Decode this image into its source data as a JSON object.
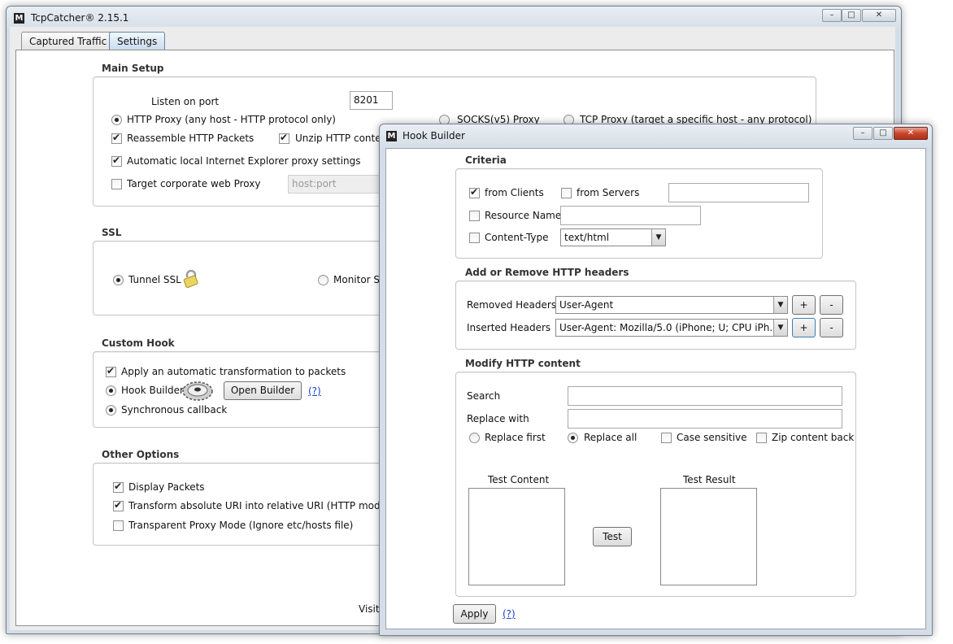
{
  "main_window": {
    "title": "TcpCatcher® 2.15.1",
    "tabs": [
      {
        "label": "Captured Traffic",
        "active": false
      },
      {
        "label": "Settings",
        "active": true
      }
    ],
    "main_setup": {
      "title": "Main Setup",
      "listen_label": "Listen on port",
      "listen_value": "8201",
      "http_proxy": "HTTP Proxy (any host - HTTP protocol only)",
      "socks_proxy": "SOCKS(v5) Proxy",
      "tcp_proxy": "TCP Proxy (target a specific host - any protocol)",
      "reassemble": "Reassemble HTTP Packets",
      "unzip": "Unzip HTTP conten",
      "ie_proxy": "Automatic local Internet Explorer proxy settings",
      "corp_proxy": "Target corporate web Proxy",
      "corp_placeholder": "host:port"
    },
    "ssl": {
      "title": "SSL",
      "tunnel": "Tunnel SSL",
      "monitor": "Monitor SS"
    },
    "custom_hook": {
      "title": "Custom Hook",
      "apply_auto": "Apply an automatic transformation to packets",
      "hook_builder": "Hook Builder",
      "open_builder": "Open Builder",
      "help": "(?)",
      "sync": "Synchronous callback"
    },
    "other": {
      "title": "Other Options",
      "display_packets": "Display Packets",
      "transform_uri": "Transform absolute URI into relative URI (HTTP mode or",
      "transparent": "Transparent Proxy Mode (Ignore etc/hosts file)"
    },
    "footer_text": "Visit"
  },
  "hook_window": {
    "title": "Hook Builder",
    "criteria": {
      "title": "Criteria",
      "from_clients": "from Clients",
      "from_servers": "from Servers",
      "resource_name": "Resource Name",
      "content_type": "Content-Type",
      "content_type_value": "text/html"
    },
    "headers": {
      "title": "Add or Remove HTTP headers",
      "removed_label": "Removed Headers",
      "removed_value": "User-Agent",
      "inserted_label": "Inserted Headers",
      "inserted_value": "User-Agent:    Mozilla/5.0 (iPhone; U; CPU iPh...",
      "plus": "+",
      "minus": "-"
    },
    "modify": {
      "title": "Modify HTTP content",
      "search_label": "Search",
      "replace_label": "Replace with",
      "replace_first": "Replace first",
      "replace_all": "Replace all",
      "case_sensitive": "Case sensitive",
      "zip_back": "Zip content back",
      "test_content": "Test Content",
      "test_result": "Test Result",
      "test_button": "Test"
    },
    "apply_button": "Apply",
    "help": "(?)"
  }
}
